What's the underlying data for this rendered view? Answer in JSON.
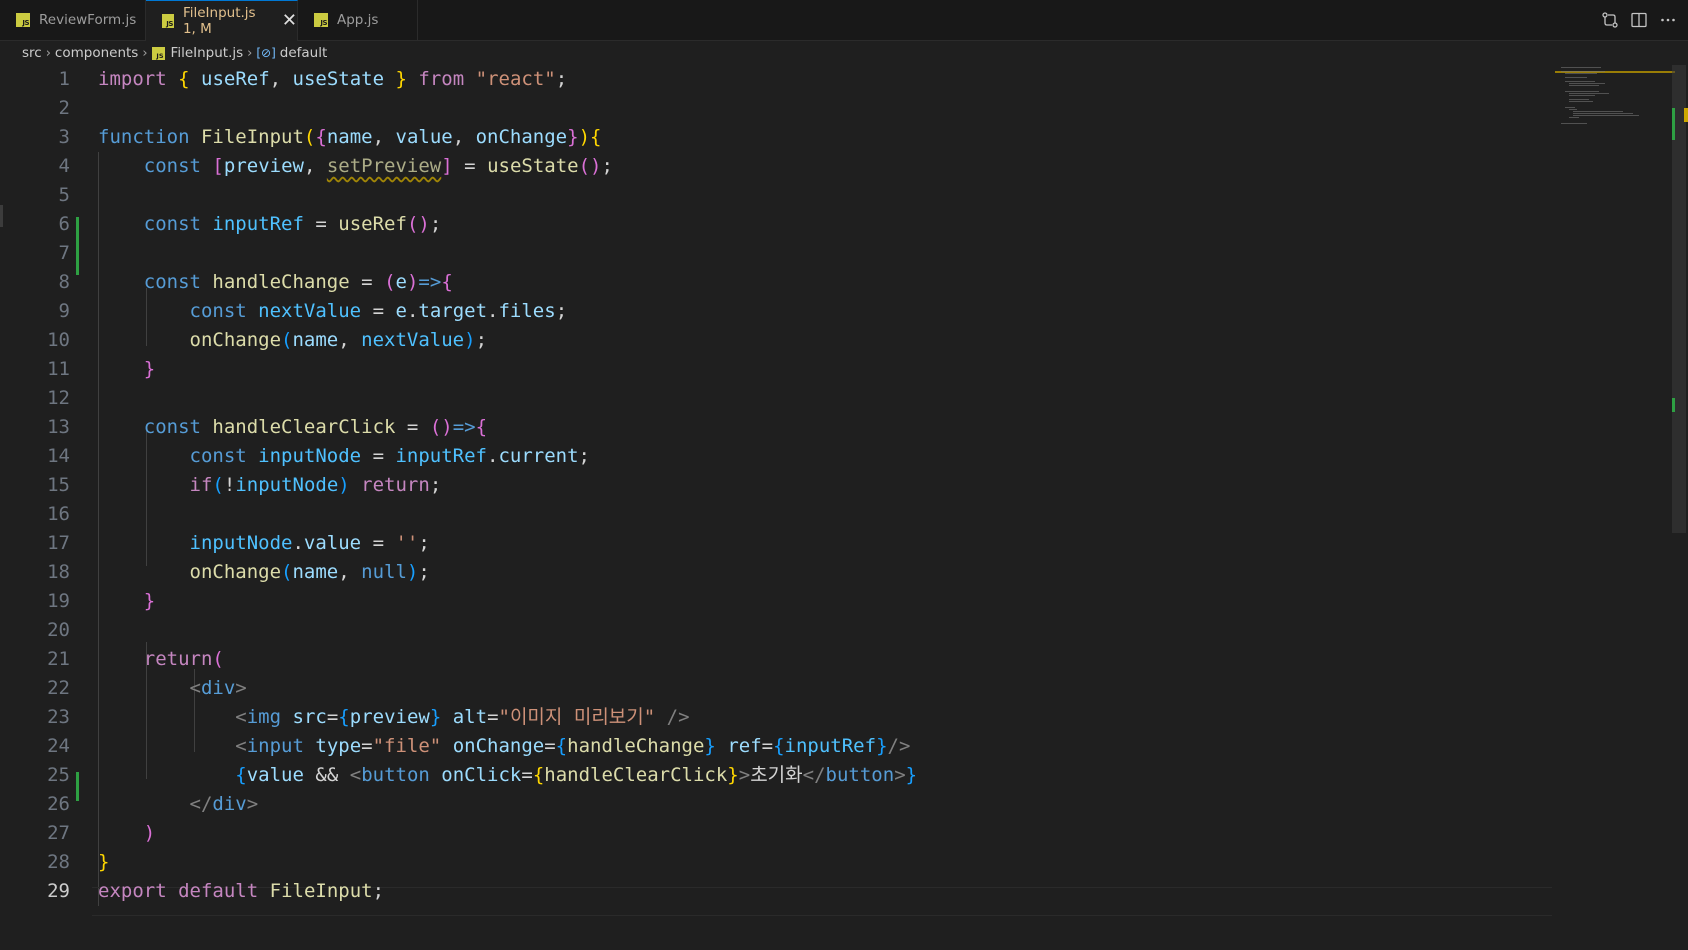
{
  "tabs": [
    {
      "label": "ReviewForm.js",
      "icon": "js-file-icon",
      "active": false
    },
    {
      "label": "FileInput.js 1, M",
      "icon": "js-file-icon",
      "active": true
    },
    {
      "label": "App.js",
      "icon": "js-file-icon",
      "active": false
    }
  ],
  "tab_close_glyph": "✕",
  "tab_actions": [
    "compare-changes-icon",
    "split-editor-icon",
    "more-actions-icon"
  ],
  "breadcrumb": {
    "items": [
      "src",
      "components",
      "FileInput.js",
      "default"
    ]
  },
  "editor": {
    "current_line": 29,
    "line_numbers": [
      "1",
      "2",
      "3",
      "4",
      "5",
      "6",
      "7",
      "8",
      "9",
      "10",
      "11",
      "12",
      "13",
      "14",
      "15",
      "16",
      "17",
      "18",
      "19",
      "20",
      "21",
      "22",
      "23",
      "24",
      "25",
      "26",
      "27",
      "28",
      "29"
    ],
    "code": {
      "l1": {
        "import": "import",
        "ob": "{",
        "useRef": "useRef",
        "comma": ",",
        "useState": "useState",
        "cb": "}",
        "from": "from",
        "react": "\"react\"",
        "semi": ";"
      },
      "l3": {
        "function": "function",
        "name": "FileInput",
        "op": "(",
        "ob": "{",
        "a1": "name",
        "c1": ",",
        "a2": "value",
        "c2": ",",
        "a3": "onChange",
        "cb": "}",
        "cp": ")",
        "obrace": "{"
      },
      "l4": {
        "const": "const",
        "ob": "[",
        "preview": "preview",
        "comma": ",",
        "setPreview": "setPreview",
        "cb": "]",
        "eq": "=",
        "useState": "useState",
        "par": "()",
        "semi": ";"
      },
      "l6": {
        "const": "const",
        "inputRef": "inputRef",
        "eq": "=",
        "useRef": "useRef",
        "par": "()",
        "semi": ";"
      },
      "l8": {
        "const": "const",
        "handleChange": "handleChange",
        "eq": "=",
        "op": "(",
        "e": "e",
        "cp": ")",
        "arrow": "=>",
        "ob": "{"
      },
      "l9": {
        "const": "const",
        "nextValue": "nextValue",
        "eq": "=",
        "e": "e",
        "d1": ".",
        "target": "target",
        "d2": ".",
        "files": "files",
        "semi": ";"
      },
      "l10": {
        "onChange": "onChange",
        "op": "(",
        "name": "name",
        "comma": ",",
        "nextValue": "nextValue",
        "cp": ")",
        "semi": ";"
      },
      "l11": {
        "cb": "}"
      },
      "l13": {
        "const": "const",
        "handleClearClick": "handleClearClick",
        "eq": "=",
        "par": "()",
        "arrow": "=>",
        "ob": "{"
      },
      "l14": {
        "const": "const",
        "inputNode": "inputNode",
        "eq": "=",
        "inputRef": "inputRef",
        "dot": ".",
        "current": "current",
        "semi": ";"
      },
      "l15": {
        "if": "if",
        "op": "(",
        "not": "!",
        "inputNode": "inputNode",
        "cp": ")",
        "return": "return",
        "semi": ";"
      },
      "l17": {
        "inputNode": "inputNode",
        "dot": ".",
        "value": "value",
        "eq": "=",
        "str": "''",
        "semi": ";"
      },
      "l18": {
        "onChange": "onChange",
        "op": "(",
        "name": "name",
        "comma": ",",
        "null": "null",
        "cp": ")",
        "semi": ";"
      },
      "l19": {
        "cb": "}"
      },
      "l21": {
        "return": "return",
        "op": "("
      },
      "l22": {
        "lt": "<",
        "div": "div",
        "gt": ">"
      },
      "l23": {
        "lt": "<",
        "img": "img",
        "src": "src",
        "eq1": "=",
        "ob": "{",
        "preview": "preview",
        "cb": "}",
        "alt": "alt",
        "eq2": "=",
        "altval": "\"이미지 미리보기\"",
        "close": "/>"
      },
      "l24": {
        "lt": "<",
        "input": "input",
        "type": "type",
        "eq1": "=",
        "typeval": "\"file\"",
        "onChange": "onChange",
        "eq2": "=",
        "ob1": "{",
        "handleChange": "handleChange",
        "cb1": "}",
        "ref": "ref",
        "eq3": "=",
        "ob2": "{",
        "inputRef": "inputRef",
        "cb2": "}",
        "close": "/>"
      },
      "l25": {
        "ob": "{",
        "value": "value",
        "and": "&&",
        "lt": "<",
        "button": "button",
        "onClick": "onClick",
        "eq": "=",
        "ob2": "{",
        "handleClearClick": "handleClearClick",
        "cb2": "}",
        "gt": ">",
        "text": "초기화",
        "lt2": "</",
        "button2": "button",
        "gt2": ">",
        "cb": "}"
      },
      "l26": {
        "lt": "</",
        "div": "div",
        "gt": ">"
      },
      "l27": {
        "cp": ")"
      },
      "l28": {
        "cb": "}"
      },
      "l29": {
        "export": "export",
        "default": "default",
        "name": "FileInput",
        "semi": ";"
      }
    }
  },
  "colors": {
    "background": "#1f1f1f",
    "tabbar": "#181818",
    "active_tab_text": "#e2c08d",
    "keyword": "#c586c0",
    "storage": "#569cd6",
    "function": "#dcdcaa",
    "variable": "#9cdcfe",
    "string": "#ce9178",
    "diff_added": "#2ea043"
  }
}
